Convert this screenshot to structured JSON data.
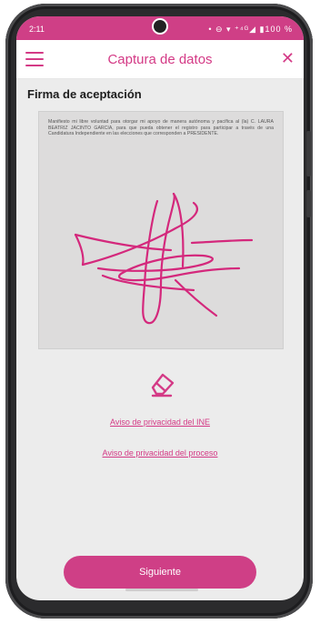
{
  "status_bar": {
    "time": "2:11",
    "icons_text": "• ⊖ ▾ ⁺⁴ᴳ◢ ▮100 %"
  },
  "app_bar": {
    "title": "Captura de datos",
    "menu_icon": "hamburger-menu-icon",
    "close_icon": "close-icon"
  },
  "section": {
    "title": "Firma de aceptación"
  },
  "signature_card": {
    "manifest_text": "Manifiesto mi libre voluntad para otorgar mi apoyo de manera autónoma y pacífica al (la) C. LAURA BEATRIZ JACINTO GARCIA, para que pueda obtener el registro para participar a través de una Candidatura Independiente en las elecciones que corresponden a PRESIDENTE."
  },
  "eraser_icon": "eraser-icon",
  "links": {
    "privacy_ine": "Aviso de privacidad del INE",
    "privacy_process": "Aviso de privacidad del proceso"
  },
  "buttons": {
    "next": "Siguiente"
  },
  "colors": {
    "accent": "#d43a86",
    "status_bar": "#cf3f86"
  }
}
